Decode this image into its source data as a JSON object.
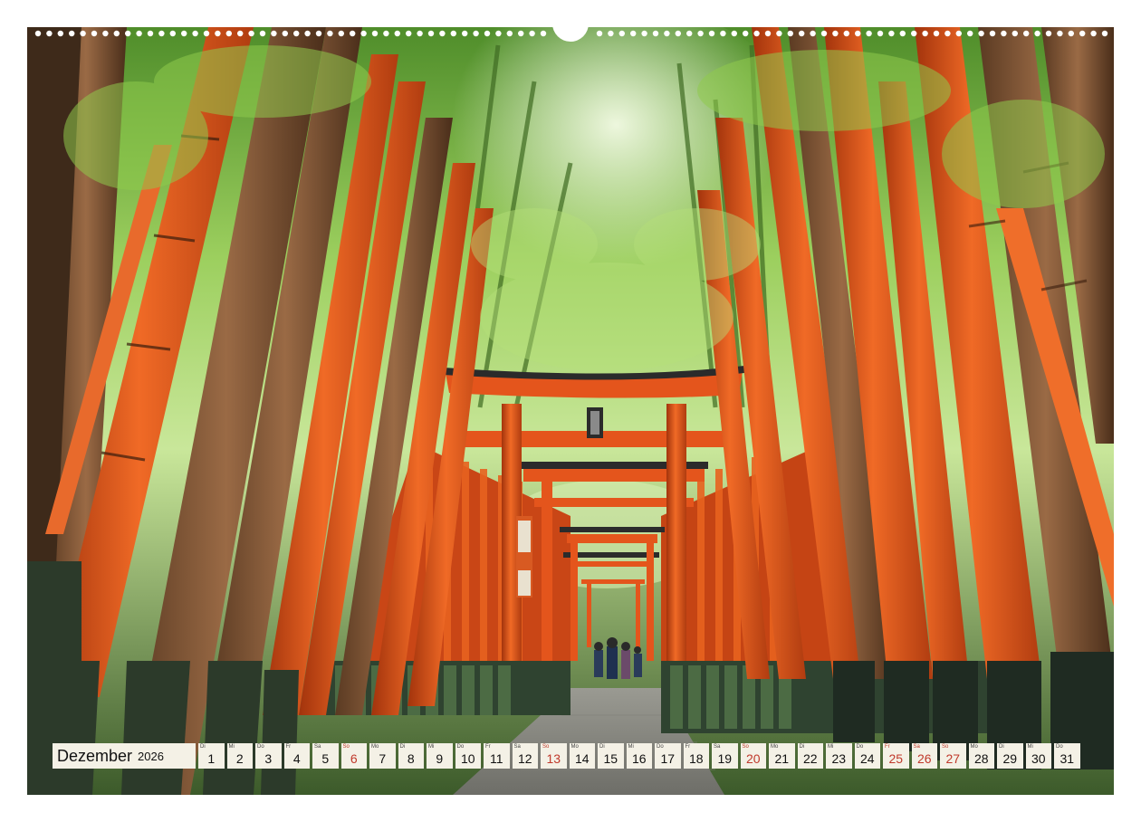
{
  "calendar": {
    "month": "Dezember",
    "year": "2026",
    "days": [
      {
        "dow": "Di",
        "num": "1"
      },
      {
        "dow": "Mi",
        "num": "2"
      },
      {
        "dow": "Do",
        "num": "3"
      },
      {
        "dow": "Fr",
        "num": "4"
      },
      {
        "dow": "Sa",
        "num": "5"
      },
      {
        "dow": "So",
        "num": "6"
      },
      {
        "dow": "Mo",
        "num": "7"
      },
      {
        "dow": "Di",
        "num": "8"
      },
      {
        "dow": "Mi",
        "num": "9"
      },
      {
        "dow": "Do",
        "num": "10"
      },
      {
        "dow": "Fr",
        "num": "11"
      },
      {
        "dow": "Sa",
        "num": "12"
      },
      {
        "dow": "So",
        "num": "13"
      },
      {
        "dow": "Mo",
        "num": "14"
      },
      {
        "dow": "Di",
        "num": "15"
      },
      {
        "dow": "Mi",
        "num": "16"
      },
      {
        "dow": "Do",
        "num": "17"
      },
      {
        "dow": "Fr",
        "num": "18"
      },
      {
        "dow": "Sa",
        "num": "19"
      },
      {
        "dow": "So",
        "num": "20"
      },
      {
        "dow": "Mo",
        "num": "21"
      },
      {
        "dow": "Di",
        "num": "22"
      },
      {
        "dow": "Mi",
        "num": "23"
      },
      {
        "dow": "Do",
        "num": "24"
      },
      {
        "dow": "Fr",
        "num": "25"
      },
      {
        "dow": "Sa",
        "num": "26"
      },
      {
        "dow": "So",
        "num": "27"
      },
      {
        "dow": "Mo",
        "num": "28"
      },
      {
        "dow": "Di",
        "num": "29"
      },
      {
        "dow": "Mi",
        "num": "30"
      },
      {
        "dow": "Do",
        "num": "31"
      }
    ],
    "red_days": [
      "6",
      "13",
      "20",
      "25",
      "26",
      "27"
    ]
  },
  "colors": {
    "torii_orange": "#e4551c",
    "torii_dark": "#2b2b2b",
    "bamboo_green": "#7fc241",
    "canopy_light": "#cfe9a8",
    "holiday_red": "#c0392b",
    "strip_bg": "#f4f1e6"
  },
  "icons": {
    "binding": "spiral-binding-icon"
  }
}
